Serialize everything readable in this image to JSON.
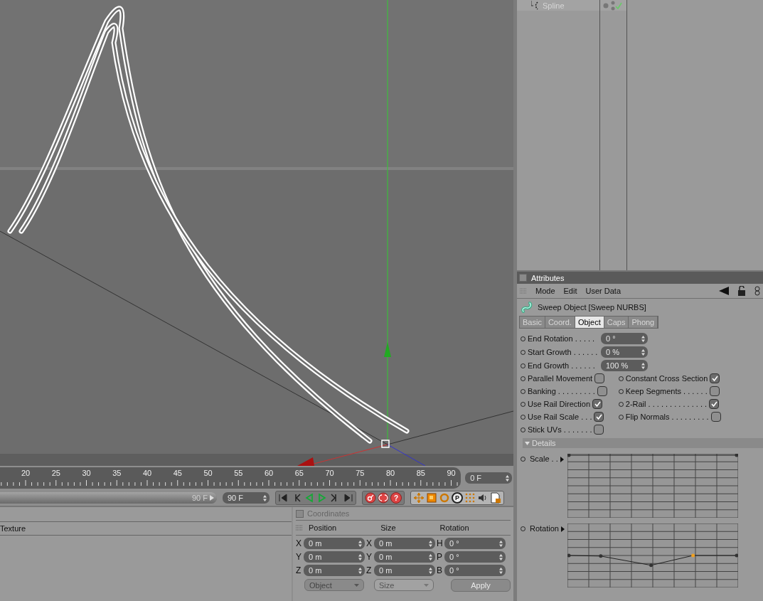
{
  "object_manager": {
    "rows": [
      {
        "name": "Spline"
      }
    ]
  },
  "timeline": {
    "ticks": [
      "20",
      "25",
      "30",
      "35",
      "40",
      "45",
      "50",
      "55",
      "60",
      "65",
      "70",
      "75",
      "80",
      "85",
      "90"
    ],
    "current_frame": "0 F"
  },
  "playback": {
    "range_end": "90 F",
    "range_bar": {
      "level": 1
    },
    "max_frame": "90 F",
    "help_label": "?",
    "param_label": "P"
  },
  "material_manager": {
    "header": "Texture"
  },
  "coordinates": {
    "title": "Coordinates",
    "checked": false,
    "columns": [
      "Position",
      "Size",
      "Rotation"
    ],
    "rows": [
      {
        "axes": [
          "X",
          "X",
          "H"
        ],
        "values": [
          "0 m",
          "0 m",
          "0 °"
        ]
      },
      {
        "axes": [
          "Y",
          "Y",
          "P"
        ],
        "values": [
          "0 m",
          "0 m",
          "0 °"
        ]
      },
      {
        "axes": [
          "Z",
          "Z",
          "B"
        ],
        "values": [
          "0 m",
          "0 m",
          "0 °"
        ]
      }
    ],
    "dropdowns": [
      {
        "label": "Object",
        "disabled": false
      },
      {
        "label": "Size",
        "disabled": true
      }
    ],
    "apply": "Apply"
  },
  "attributes": {
    "title": "Attributes",
    "checked": false,
    "menu": [
      "Mode",
      "Edit",
      "User Data"
    ],
    "object_title": "Sweep Object [Sweep NURBS]",
    "tabs": [
      {
        "label": "Basic",
        "selected": false
      },
      {
        "label": "Coord.",
        "selected": false
      },
      {
        "label": "Object",
        "selected": true
      },
      {
        "label": "Caps",
        "selected": false
      },
      {
        "label": "Phong",
        "selected": false
      }
    ],
    "fields": [
      {
        "label": "End Rotation . . . . .",
        "value": "0 °"
      },
      {
        "label": "Start Growth . . . . . .",
        "value": "0 %"
      },
      {
        "label": "End Growth . . . . . .",
        "value": "100 %"
      }
    ],
    "options_left": [
      {
        "label": "Parallel Movement",
        "checked": false
      },
      {
        "label": "Banking . . . . . . . . .",
        "checked": false
      },
      {
        "label": "Use Rail Direction",
        "checked": true
      },
      {
        "label": "Use Rail Scale . . .",
        "checked": true
      },
      {
        "label": "Stick UVs . . . . . . .",
        "checked": false
      }
    ],
    "options_right": [
      {
        "label": "Constant Cross Section",
        "checked": true
      },
      {
        "label": "Keep Segments . . . . . .",
        "checked": false
      },
      {
        "label": "2-Rail . . . . . . . . . . . . . .",
        "checked": true
      },
      {
        "label": "Flip Normals . . . . . . . . .",
        "checked": false
      }
    ],
    "details": {
      "title": "Details",
      "expanded": true,
      "graphs": [
        {
          "label": "Scale . .",
          "kind": "flat"
        },
        {
          "label": "Rotation",
          "kind": "dip"
        }
      ]
    }
  }
}
